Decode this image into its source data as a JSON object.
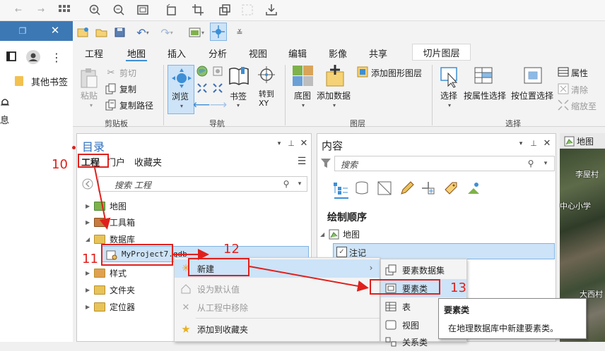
{
  "browser": {
    "other_bookmarks": "其他书签",
    "partial_text": "息"
  },
  "ribbon": {
    "tabs": [
      "工程",
      "地图",
      "插入",
      "分析",
      "视图",
      "编辑",
      "影像",
      "共享"
    ],
    "context_tab": "切片图层",
    "clipboard": {
      "paste": "粘贴",
      "cut": "剪切",
      "copy": "复制",
      "copy_path": "复制路径",
      "group": "剪贴板"
    },
    "navigate": {
      "explore": "浏览",
      "bookmarks": "书签",
      "goto": "转到\nXY",
      "group": "导航"
    },
    "layer": {
      "basemap": "底图",
      "add_data": "添加数据",
      "add_graphics_layer": "添加图形图层",
      "group": "图层"
    },
    "selection": {
      "select": "选择",
      "select_by_attr": "按属性选择",
      "select_by_loc": "按位置选择",
      "group": "选择"
    },
    "right": {
      "attributes": "属性",
      "clear": "清除",
      "zoom_to": "缩放至"
    }
  },
  "catalog": {
    "title": "目录",
    "tabs": [
      "工程",
      "门户",
      "收藏夹"
    ],
    "search_placeholder": "搜索 工程",
    "tree": [
      "地图",
      "工具箱",
      "数据库",
      "MyProject7.gdb",
      "样式",
      "文件夹",
      "定位器"
    ]
  },
  "contents": {
    "title": "内容",
    "search_placeholder": "搜索",
    "drawing_order": "绘制顺序",
    "map": "地图",
    "annotation": "注记"
  },
  "map_tab": {
    "title": "地图",
    "labels": [
      "李屋村",
      "中心小学",
      "大西村"
    ]
  },
  "context_menu": {
    "items": [
      "新建",
      "设为默认值",
      "从工程中移除",
      "添加到收藏夹"
    ]
  },
  "submenu": {
    "items": [
      "要素数据集",
      "要素类",
      "表",
      "视图",
      "关系类"
    ]
  },
  "tooltip": {
    "title": "要素类",
    "body": "在地理数据库中新建要素类。"
  },
  "annotations": {
    "n10": "10",
    "n11": "11",
    "n12": "12",
    "n13": "13"
  }
}
